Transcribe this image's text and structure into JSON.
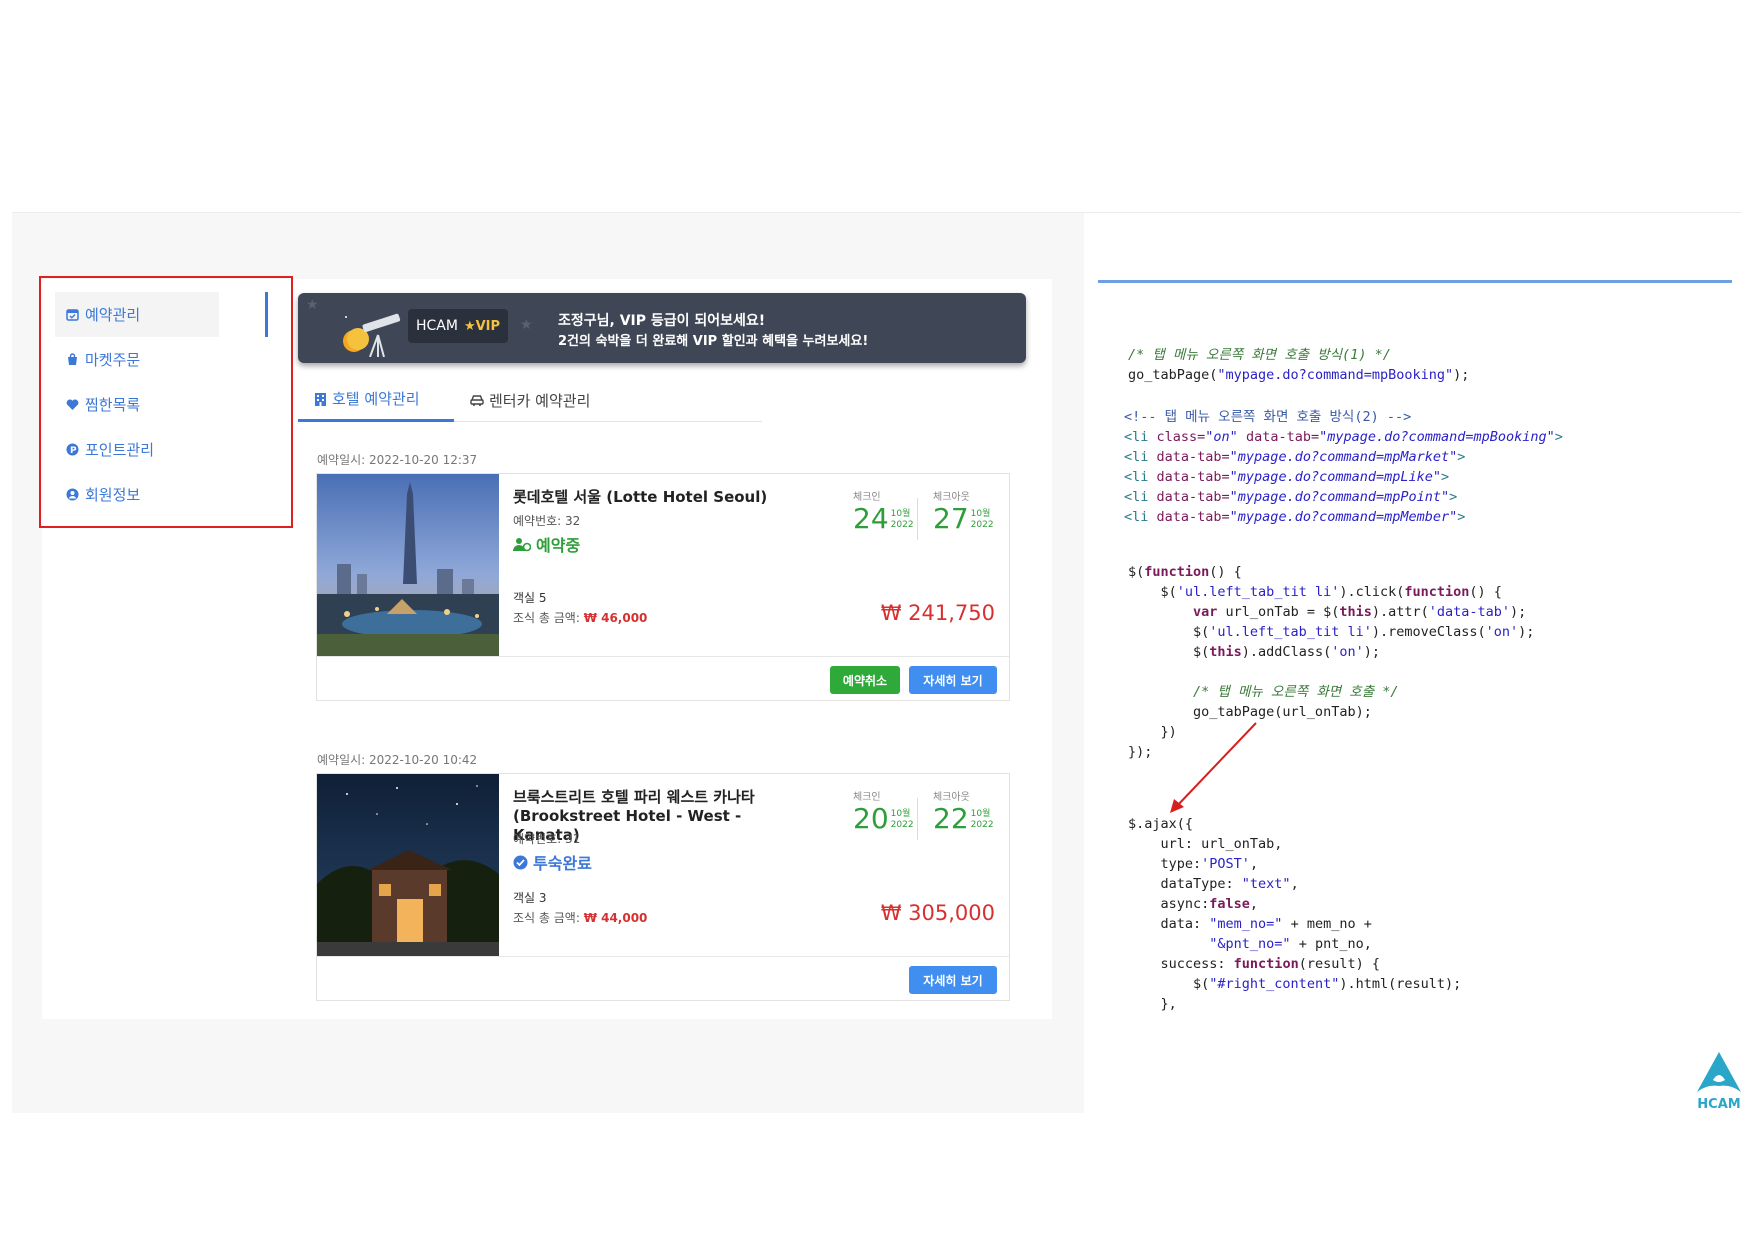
{
  "sidebar": {
    "items": [
      {
        "label": "예약관리",
        "icon": "calendar-icon"
      },
      {
        "label": "마켓주문",
        "icon": "shopping-bag-icon"
      },
      {
        "label": "찜한목록",
        "icon": "heart-icon"
      },
      {
        "label": "포인트관리",
        "icon": "point-icon"
      },
      {
        "label": "회원정보",
        "icon": "user-icon"
      }
    ]
  },
  "banner": {
    "brand": "HCAM",
    "vip": "★VIP",
    "line1": "조정구님, VIP 등급이 되어보세요!",
    "line2": "2건의 숙박을 더 완료해 VIP 할인과 혜택을 누려보세요!"
  },
  "tabs": [
    {
      "label": "호텔 예약관리",
      "icon": "hotel-icon"
    },
    {
      "label": "렌터카 예약관리",
      "icon": "car-icon"
    }
  ],
  "bookings": [
    {
      "booked_at": "예약일시: 2022-10-20 12:37",
      "name": "롯데호텔 서울 (Lotte Hotel Seoul)",
      "booking_no_label": "예약번호: ",
      "booking_no": "32",
      "status": "예약중",
      "room": "객실 5",
      "breakfast_label": "조식 총 금액: ",
      "breakfast_amount": "₩ 46,000",
      "checkin_label": "체크인",
      "checkin_day": "24",
      "checkin_month": "10월",
      "checkin_year": "2022",
      "checkout_label": "체크아웃",
      "checkout_day": "27",
      "checkout_month": "10월",
      "checkout_year": "2022",
      "price": "₩ 241,750",
      "cancel_label": "예약취소",
      "detail_label": "자세히 보기"
    },
    {
      "booked_at": "예약일시: 2022-10-20 10:42",
      "name": "브룩스트리트 호텔 파리 웨스트 카나타 (Brookstreet Hotel - West - Kanata)",
      "booking_no_label": "예약번호: ",
      "booking_no": "31",
      "status": "투숙완료",
      "room": "객실 3",
      "breakfast_label": "조식 총 금액: ",
      "breakfast_amount": "₩ 44,000",
      "checkin_label": "체크인",
      "checkin_day": "20",
      "checkin_month": "10월",
      "checkin_year": "2022",
      "checkout_label": "체크아웃",
      "checkout_day": "22",
      "checkout_month": "10월",
      "checkout_year": "2022",
      "price": "₩ 305,000",
      "detail_label": "자세히 보기"
    }
  ],
  "code": {
    "block1_comment": "/* 탭 메뉴 오른쪽 화면 호출 방식(1) */",
    "block1_fn": "go_tabPage(",
    "block1_arg": "\"mypage.do?command=mpBooking\"",
    "block1_end": ");",
    "block2_comment": "<!-- 탭 메뉴 오른쪽 화면 호출 방식(2) -->",
    "block3_comment": "/* 탭 메뉴 오른쪽 화면 호출 */",
    "logo_text": "HCAM"
  },
  "colors": {
    "accent": "#3b78d8",
    "green": "#2faa3a",
    "price_red": "#d63030",
    "banner_bg": "#3f4756",
    "highlight_box": "#e02020"
  }
}
